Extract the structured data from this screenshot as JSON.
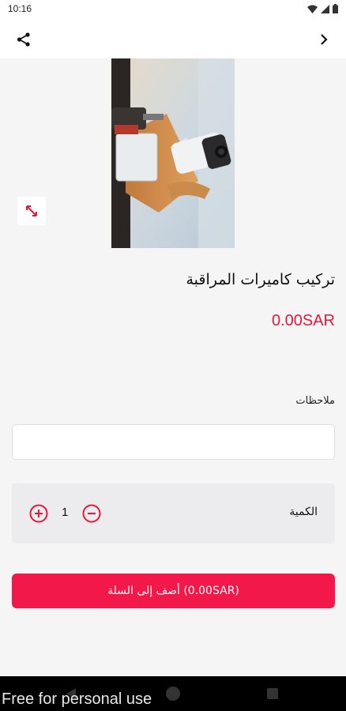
{
  "status_bar": {
    "time": "10:16"
  },
  "app_bar": {
    "share_icon": "share-icon",
    "next_icon": "chevron-right-icon"
  },
  "product": {
    "image_icon": "cctv-camera-photo",
    "title": "تركيب كاميرات المراقبة",
    "price": "0.00SAR"
  },
  "notes": {
    "label": "ملاحظات",
    "value": "",
    "placeholder": ""
  },
  "quantity": {
    "label": "الكمية",
    "value": "1"
  },
  "cart": {
    "button_label": "أضف إلى السلة (0.00SAR)"
  },
  "watermark": "Free for personal use",
  "colors": {
    "accent": "#f2194a",
    "price": "#e8173a",
    "background": "#f5f5f5"
  }
}
